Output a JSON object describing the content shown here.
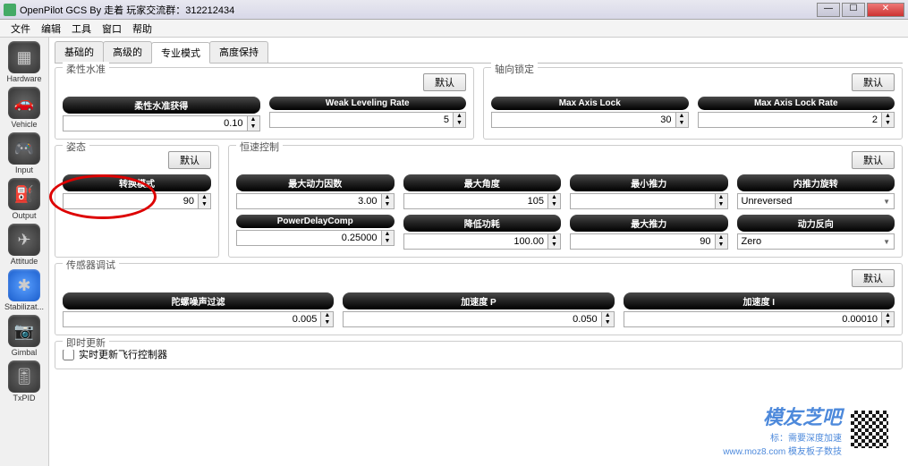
{
  "window": {
    "title": "OpenPilot GCS       By 走着    玩家交流群：312212434",
    "min": "—",
    "max": "☐",
    "close": "✕"
  },
  "menu": [
    "文件",
    "编辑",
    "工具",
    "窗口",
    "帮助"
  ],
  "sidebar": [
    {
      "label": "Hardware",
      "glyph": "▦"
    },
    {
      "label": "Vehicle",
      "glyph": "🚗"
    },
    {
      "label": "Input",
      "glyph": "🎮"
    },
    {
      "label": "Output",
      "glyph": "⛽"
    },
    {
      "label": "Attitude",
      "glyph": "✈"
    },
    {
      "label": "Stabilizat...",
      "glyph": "✱",
      "selected": true
    },
    {
      "label": "Gimbal",
      "glyph": "📷"
    },
    {
      "label": "TxPID",
      "glyph": "🎚"
    }
  ],
  "tabs": [
    {
      "label": "基础的"
    },
    {
      "label": "高级的"
    },
    {
      "label": "专业模式",
      "active": true
    },
    {
      "label": "高度保持"
    }
  ],
  "buttons": {
    "default": "默认"
  },
  "groups": {
    "flex": {
      "title": "柔性水准",
      "fields": {
        "gain": {
          "label": "柔性水准获得",
          "value": "0.10"
        },
        "rate": {
          "label": "Weak Leveling Rate",
          "value": "5"
        }
      }
    },
    "axislock": {
      "title": "轴向锁定",
      "fields": {
        "max": {
          "label": "Max Axis Lock",
          "value": "30"
        },
        "rate": {
          "label": "Max Axis Lock Rate",
          "value": "2"
        }
      }
    },
    "posture": {
      "title": "姿态",
      "mode": {
        "label": "转换模式",
        "value": "90"
      }
    },
    "speed": {
      "title": "恒速控制",
      "row1": {
        "power": {
          "label": "最大动力因数",
          "value": "3.00"
        },
        "angle": {
          "label": "最大角度",
          "value": "105"
        },
        "minthrust": {
          "label": "最小推力",
          "value": ""
        },
        "innerrot": {
          "label": "内推力旋转",
          "value": "Unreversed"
        }
      },
      "row2": {
        "delay": {
          "label": "PowerDelayComp",
          "value": "0.25000"
        },
        "reduce": {
          "label": "降低功耗",
          "value": "100.00"
        },
        "maxthrust": {
          "label": "最大推力",
          "value": "90"
        },
        "reverse": {
          "label": "动力反向",
          "value": "Zero"
        }
      }
    },
    "sensor": {
      "title": "传感器调试",
      "fields": {
        "gyro": {
          "label": "陀螺噪声过滤",
          "value": "0.005"
        },
        "accP": {
          "label": "加速度 P",
          "value": "0.050"
        },
        "accI": {
          "label": "加速度 I",
          "value": "0.00010"
        }
      }
    },
    "realtime": {
      "title": "即时更新",
      "checkbox": "实时更新飞行控制器"
    }
  },
  "watermark": {
    "logo": "模友芝吧",
    "sub1": "标：需要深度加速",
    "sub2": "www.moz8.com  模友板子数技"
  }
}
